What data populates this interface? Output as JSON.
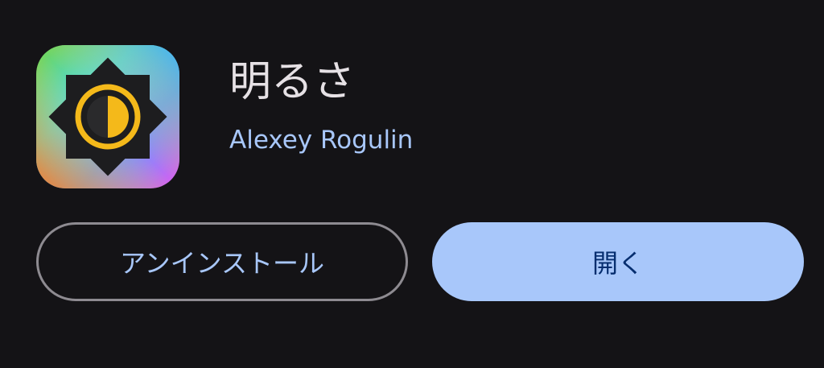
{
  "app": {
    "icon": "brightness-sun-icon",
    "title": "明るさ",
    "developer": "Alexey Rogulin"
  },
  "actions": {
    "uninstall_label": "アンインストール",
    "open_label": "開く"
  },
  "colors": {
    "background": "#141316",
    "accent": "#a8c7fa",
    "title_text": "#e6e1e5",
    "open_button_text": "#062e6f",
    "outline": "#8e8b91"
  }
}
